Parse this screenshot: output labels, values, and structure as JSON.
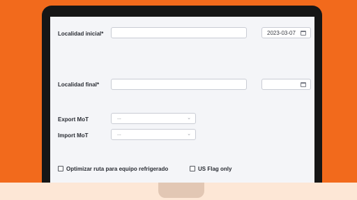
{
  "form": {
    "origin_label": "Localidad inicial*",
    "origin_value": "",
    "origin_date": "2023-03-07",
    "destination_label": "Localidad final*",
    "destination_value": "",
    "destination_date": "",
    "export_mot_label": "Export MoT",
    "export_mot_value": "...",
    "import_mot_label": "Import MoT",
    "import_mot_value": "...",
    "refrigerated_label": "Optimizar ruta para equipo refrigerado",
    "refrigerated_checked": false,
    "usflag_label": "US Flag only",
    "usflag_checked": false
  },
  "icons": {
    "date": "calendar-icon",
    "select": "chevron-down-icon"
  },
  "colors": {
    "background": "#f26a1c",
    "bezel": "#161616",
    "screen": "#f4f5f8",
    "base": "#fde7d6"
  }
}
